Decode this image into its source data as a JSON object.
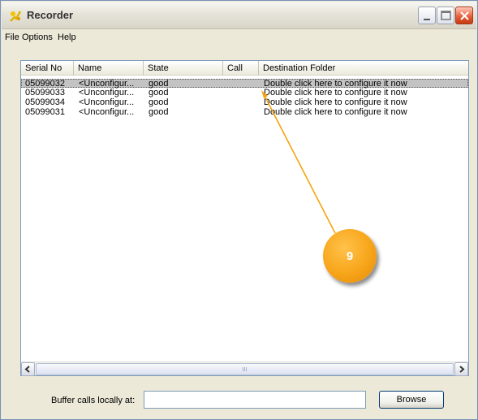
{
  "window": {
    "title": "Recorder",
    "icon": "recorder-app-icon",
    "controls": [
      "minimize-icon",
      "maximize-icon",
      "close-icon"
    ]
  },
  "menu": [
    {
      "label": "File"
    },
    {
      "label": "Options"
    },
    {
      "label": "Help"
    }
  ],
  "list": {
    "columns": [
      {
        "label": "Serial No"
      },
      {
        "label": "Name"
      },
      {
        "label": "State"
      },
      {
        "label": "Call"
      },
      {
        "label": "Destination Folder"
      }
    ],
    "rows": [
      {
        "serial": "05099032",
        "name": "<Unconfigur...",
        "state": "good",
        "call": "",
        "destination": "Double click here to configure it now",
        "selected": true
      },
      {
        "serial": "05099033",
        "name": "<Unconfigur...",
        "state": "good",
        "call": "",
        "destination": "Double click here to configure it now",
        "selected": false
      },
      {
        "serial": "05099034",
        "name": "<Unconfigur...",
        "state": "good",
        "call": "",
        "destination": "Double click here to configure it now",
        "selected": false
      },
      {
        "serial": "05099031",
        "name": "<Unconfigur...",
        "state": "good",
        "call": "",
        "destination": "Double click here to configure it now",
        "selected": false
      }
    ]
  },
  "scrollbar": {
    "left_icon": "scroll-left-icon",
    "right_icon": "scroll-right-icon",
    "grip": "III"
  },
  "buffer": {
    "label": "Buffer calls locally at:",
    "value": "",
    "placeholder": ""
  },
  "browse_label": "Browse",
  "annotation": {
    "number": "9",
    "color": "#f7a51a"
  },
  "colors": {
    "selected_row": "#c3c3c3",
    "window_bg": "#ece9d8",
    "list_border": "#7f9db9"
  }
}
